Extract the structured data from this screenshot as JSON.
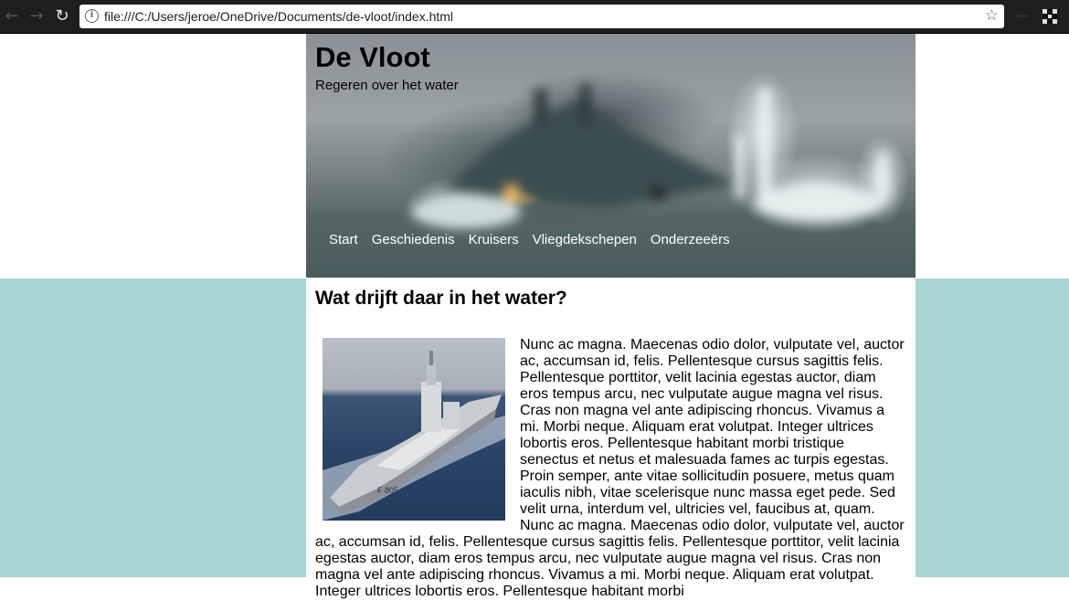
{
  "browser": {
    "url": "file:///C:/Users/jeroe/OneDrive/Documents/de-vloot/index.html",
    "back_icon": "back-arrow-icon",
    "forward_icon": "forward-arrow-icon",
    "reload_icon": "reload-icon",
    "info_icon": "info-icon",
    "bookmark_icon": "star-icon"
  },
  "header": {
    "title": "De Vloot",
    "tagline": "Regeren over het water",
    "nav": [
      "Start",
      "Geschiedenis",
      "Kruisers",
      "Vliegdekschepen",
      "Onderzeeërs"
    ]
  },
  "main": {
    "heading": "Wat drijft daar in het water?",
    "image_label": "F 805",
    "paragraph": "Nunc ac magna. Maecenas odio dolor, vulputate vel, auctor ac, accumsan id, felis. Pellentesque cursus sagittis felis. Pellentesque porttitor, velit lacinia egestas auctor, diam eros tempus arcu, nec vulputate augue magna vel risus. Cras non magna vel ante adipiscing rhoncus. Vivamus a mi. Morbi neque. Aliquam erat volutpat. Integer ultrices lobortis eros. Pellentesque habitant morbi tristique senectus et netus et malesuada fames ac turpis egestas. Proin semper, ante vitae sollicitudin posuere, metus quam iaculis nibh, vitae scelerisque nunc massa eget pede. Sed velit urna, interdum vel, ultricies vel, faucibus at, quam. Nunc ac magna. Maecenas odio dolor, vulputate vel, auctor ac, accumsan id, felis. Pellentesque cursus sagittis felis. Pellentesque porttitor, velit lacinia egestas auctor, diam eros tempus arcu, nec vulputate augue magna vel risus. Cras non magna vel ante adipiscing rhoncus. Vivamus a mi. Morbi neque. Aliquam erat volutpat. Integer ultrices lobortis eros. Pellentesque habitant morbi"
  },
  "colors": {
    "side_band": "#a8d4d4",
    "nav_text": "#ffffff"
  }
}
